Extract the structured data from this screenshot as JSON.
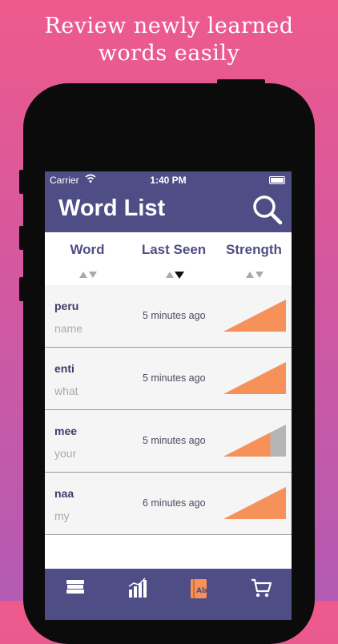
{
  "promo": {
    "headline_line1": "Review newly learned",
    "headline_line2": "words easily"
  },
  "status_bar": {
    "carrier": "Carrier",
    "time": "1:40 PM"
  },
  "nav": {
    "title": "Word List",
    "search_icon": "search-icon"
  },
  "columns": [
    {
      "label": "Word",
      "sort": "none"
    },
    {
      "label": "Last Seen",
      "sort": "descending"
    },
    {
      "label": "Strength",
      "sort": "none"
    }
  ],
  "words": [
    {
      "word": "peru",
      "meaning": "name",
      "last_seen": "5 minutes ago",
      "strength": 1.0
    },
    {
      "word": "enti",
      "meaning": "what",
      "last_seen": "5 minutes ago",
      "strength": 1.0
    },
    {
      "word": "mee",
      "meaning": "your",
      "last_seen": "5 minutes ago",
      "strength": 0.75
    },
    {
      "word": "naa",
      "meaning": "my",
      "last_seen": "6 minutes ago",
      "strength": 1.0
    }
  ],
  "tabs": [
    {
      "icon": "books-stack-icon"
    },
    {
      "icon": "bar-chart-icon"
    },
    {
      "icon": "flashcard-ab-icon",
      "active": true
    },
    {
      "icon": "shopping-cart-icon"
    }
  ],
  "colors": {
    "primary": "#4f4d86",
    "strength_fill": "#f7915a",
    "strength_empty": "#b5b5b5",
    "active_tab": "#f7915a"
  }
}
